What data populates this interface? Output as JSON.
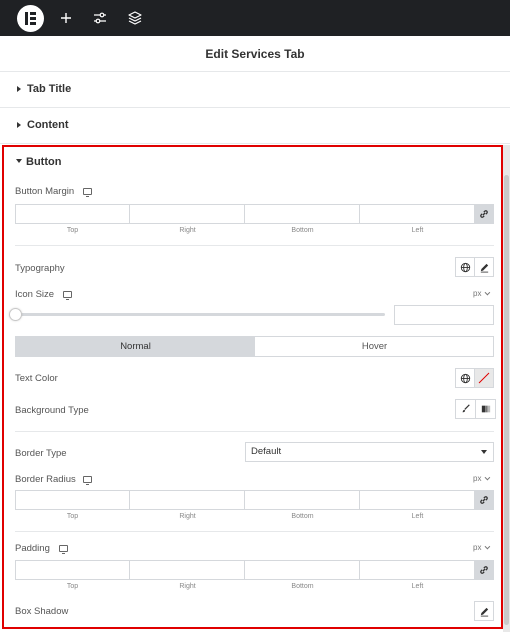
{
  "topbar": {
    "icons": [
      "elementor-logo-icon",
      "plus-icon",
      "sliders-icon",
      "layers-icon"
    ]
  },
  "panel": {
    "title": "Edit Services Tab"
  },
  "sections": {
    "tab_title": "Tab Title",
    "content": "Content",
    "button": "Button"
  },
  "controls": {
    "button_margin": {
      "label": "Button Margin",
      "sides": [
        "Top",
        "Right",
        "Bottom",
        "Left"
      ]
    },
    "typography": {
      "label": "Typography"
    },
    "icon_size": {
      "label": "Icon Size",
      "unit": "px",
      "value": 0
    },
    "state_tabs": [
      "Normal",
      "Hover"
    ],
    "text_color": {
      "label": "Text Color"
    },
    "background_type": {
      "label": "Background Type"
    },
    "border_type": {
      "label": "Border Type",
      "value": "Default"
    },
    "border_radius": {
      "label": "Border Radius",
      "unit": "px",
      "sides": [
        "Top",
        "Right",
        "Bottom",
        "Left"
      ]
    },
    "padding": {
      "label": "Padding",
      "unit": "px",
      "sides": [
        "Top",
        "Right",
        "Bottom",
        "Left"
      ]
    },
    "box_shadow": {
      "label": "Box Shadow"
    }
  },
  "colors": {
    "topbar_bg": "#1f2124",
    "highlight": "#e00000",
    "active_tab": "#d5d8dc"
  }
}
